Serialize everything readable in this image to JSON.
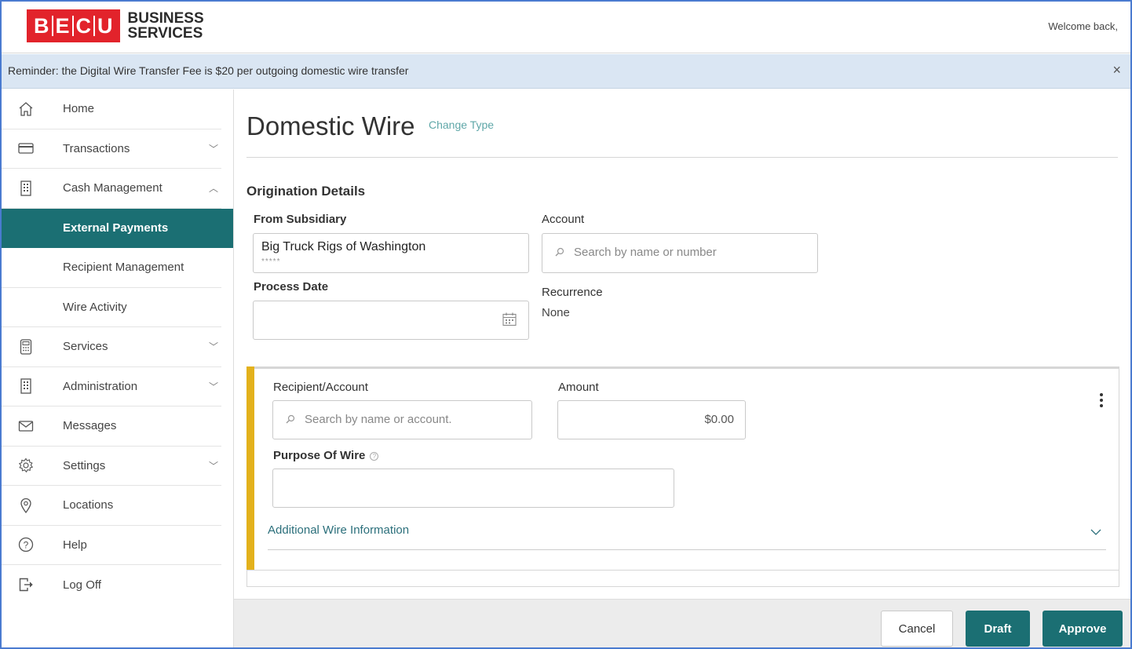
{
  "brand": {
    "letters": [
      "B",
      "E",
      "C",
      "U"
    ],
    "line1": "BUSINESS",
    "line2": "SERVICES",
    "color": "#e2232b"
  },
  "header": {
    "welcome": "Welcome back,"
  },
  "banner": {
    "text": "Reminder: the Digital Wire Transfer Fee is $20 per outgoing domestic wire transfer",
    "close": "×"
  },
  "sidebar": {
    "items": [
      {
        "label": "Home",
        "icon": "home-icon"
      },
      {
        "label": "Transactions",
        "icon": "card-icon",
        "chevron": "﹀"
      },
      {
        "label": "Cash Management",
        "icon": "building-icon",
        "chevron": "︿"
      },
      {
        "label": "External Payments",
        "active": true
      },
      {
        "label": "Recipient Management"
      },
      {
        "label": "Wire Activity"
      },
      {
        "label": "Services",
        "icon": "calculator-icon",
        "chevron": "﹀"
      },
      {
        "label": "Administration",
        "icon": "building-icon",
        "chevron": "﹀"
      },
      {
        "label": "Messages",
        "icon": "envelope-icon"
      },
      {
        "label": "Settings",
        "icon": "gear-icon",
        "chevron": "﹀"
      },
      {
        "label": "Locations",
        "icon": "map-pin-icon"
      },
      {
        "label": "Help",
        "icon": "question-icon"
      },
      {
        "label": "Log Off",
        "icon": "logout-icon"
      }
    ]
  },
  "main": {
    "title": "Domestic Wire",
    "change_type": "Change Type",
    "section": "Origination Details",
    "from_subsidiary": {
      "label": "From Subsidiary",
      "value": "Big Truck Rigs of Washington",
      "mask": "*****"
    },
    "account": {
      "label": "Account",
      "placeholder": "Search by name or number"
    },
    "process_date": {
      "label": "Process Date",
      "value": ""
    },
    "recurrence": {
      "label": "Recurrence",
      "value": "None"
    },
    "recipient": {
      "label": "Recipient/Account",
      "placeholder": "Search by name or account."
    },
    "amount": {
      "label": "Amount",
      "value": "$0.00"
    },
    "purpose": {
      "label": "Purpose Of Wire",
      "help": "?",
      "value": ""
    },
    "additional": "Additional Wire Information"
  },
  "footer": {
    "cancel": "Cancel",
    "draft": "Draft",
    "approve": "Approve"
  },
  "colors": {
    "teal": "#1b6f73",
    "accent_yellow": "#e3b11c",
    "banner_bg": "#dae6f3"
  }
}
